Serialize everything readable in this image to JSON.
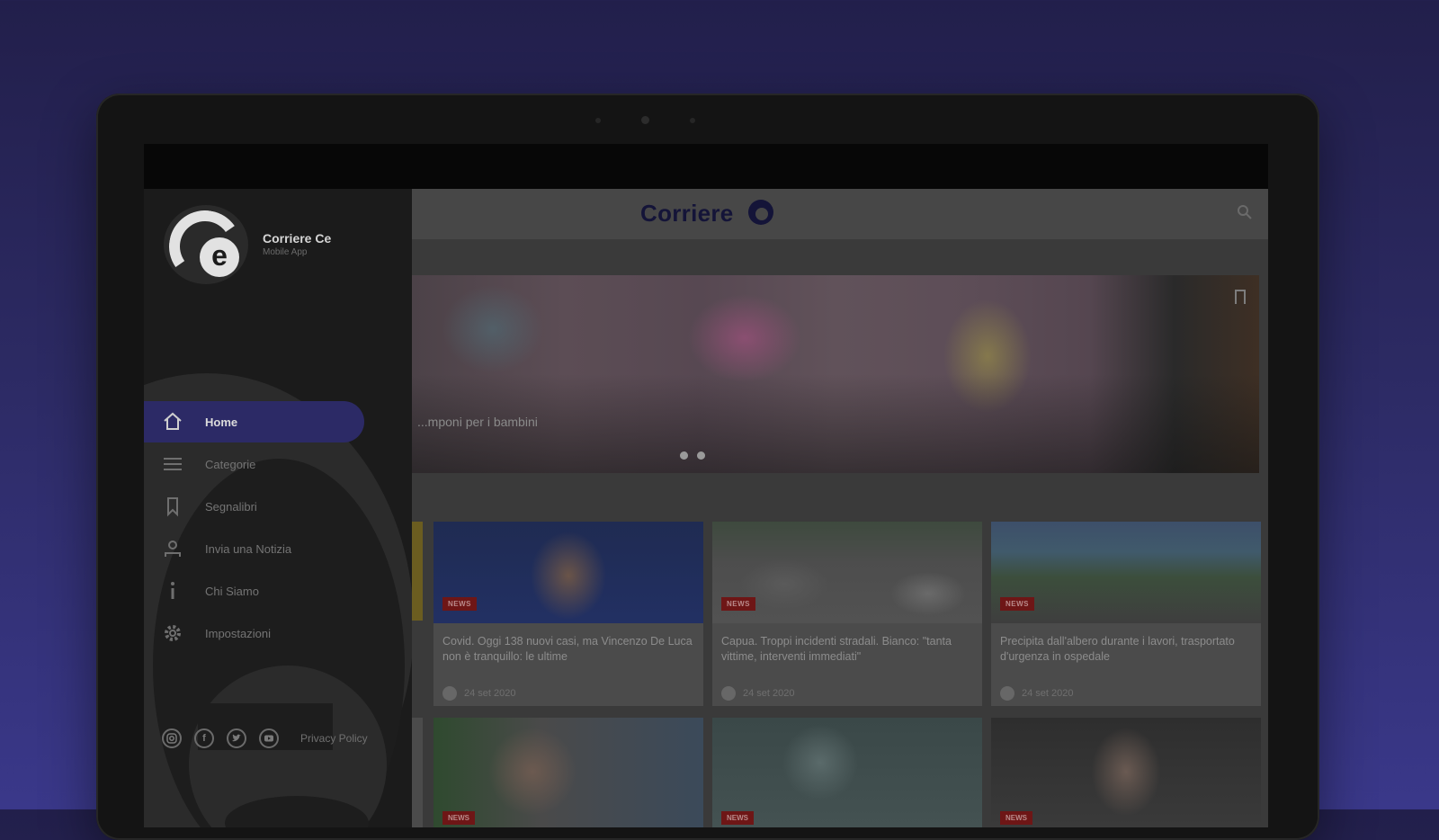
{
  "app": {
    "name": "Corriere Ce",
    "subtitle": "Mobile App",
    "header_logo": "Corriere"
  },
  "colors": {
    "accent": "#2c2a66",
    "tag": "#6e1616",
    "background_top": "#221f4b",
    "background_bottom": "#3a388a"
  },
  "sidebar": {
    "items": [
      {
        "label": "Home",
        "icon": "home-icon",
        "active": true
      },
      {
        "label": "Categorie",
        "icon": "list-icon",
        "active": false
      },
      {
        "label": "Segnalibri",
        "icon": "bookmark-icon",
        "active": false
      },
      {
        "label": "Invia una Notizia",
        "icon": "person-icon",
        "active": false
      },
      {
        "label": "Chi Siamo",
        "icon": "info-icon",
        "active": false
      },
      {
        "label": "Impostazioni",
        "icon": "gear-icon",
        "active": false
      }
    ],
    "footer": {
      "socials": [
        "instagram-icon",
        "facebook-icon",
        "twitter-icon",
        "youtube-icon"
      ],
      "privacy_label": "Privacy Policy"
    }
  },
  "hero": {
    "caption": "...mponi per i bambini",
    "dots": 2
  },
  "cards": [
    {
      "tag": "NEWS",
      "title": "Covid. Oggi 138 nuovi casi, ma Vincenzo De Luca non è tranquillo: le ultime",
      "date": "24 set 2020"
    },
    {
      "tag": "NEWS",
      "title": "Capua. Troppi incidenti stradali. Bianco: \"tanta vittime, interventi immediati\"",
      "date": "24 set 2020"
    },
    {
      "tag": "NEWS",
      "title": "Precipita dall'albero durante i lavori, trasportato d'urgenza in ospedale",
      "date": "24 set 2020"
    }
  ],
  "cards_row2": [
    {
      "tag": "NEWS"
    },
    {
      "tag": "NEWS"
    },
    {
      "tag": "NEWS"
    }
  ]
}
